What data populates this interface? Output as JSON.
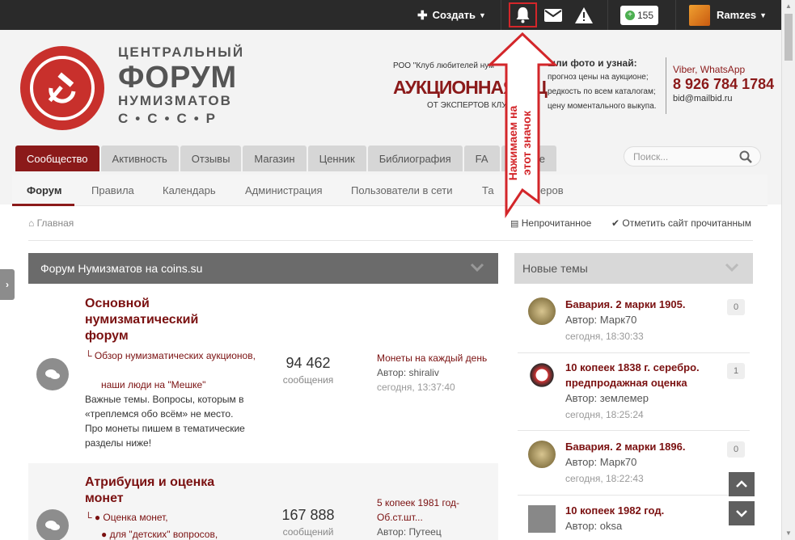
{
  "topbar": {
    "create_label": "Создать",
    "points": "155",
    "username": "Ramzes"
  },
  "header": {
    "logo": {
      "line1": "ЦЕНТРАЛЬНЫЙ",
      "line2": "ФОРУМ",
      "line3": "НУМИЗМАТОВ",
      "line4": "С•С•С•Р"
    },
    "ad": {
      "small": "РОО \"Клуб любителей нум",
      "big": "АУКЦИОННАЯ ОЦ",
      "sub": "ОТ ЭКСПЕРТОВ КЛУБА",
      "right_title": "шли фото и узнай:",
      "right_lines": [
        "прогноз цены на аукционе;",
        "редкость по всем каталогам;",
        "цену моментального выкупа."
      ],
      "viber": "Viber, WhatsApp",
      "phone_prefix": "8 926 ",
      "phone_main": "784 1784",
      "email": "bid@mailbid.ru"
    }
  },
  "nav": {
    "tabs": [
      "Сообщество",
      "Активность",
      "Отзывы",
      "Магазин",
      "Ценник",
      "Библиография",
      "FA",
      "ьше"
    ],
    "search_placeholder": "Поиск...",
    "subtabs": [
      "Форум",
      "Правила",
      "Календарь",
      "Администрация",
      "Пользователи в сети",
      "Та",
      "еров"
    ]
  },
  "breadcrumb": {
    "home": "Главная",
    "unread": "Непрочитанное",
    "mark_read": "Отметить сайт прочитанным"
  },
  "forum": {
    "category_title": "Форум Нумизматов на coins.su",
    "rows": [
      {
        "title": "Основной нумизматический форум",
        "sub1": "Обзор нумизматических аукционов,",
        "sub2": "наши люди на \"Мешке\"",
        "desc": "Важные темы. Вопросы, которым в «треплемся обо всём» не место. Про монеты пишем в тематические разделы ниже!",
        "count": "94 462",
        "count_label": "сообщения",
        "last_title": "Монеты на каждый день",
        "last_author": "Автор: shiraliv",
        "last_date": "сегодня, 13:37:40"
      },
      {
        "title": "Атрибуция и оценка монет",
        "sub1": "Оценка монет,",
        "sub2": "для \"детских\" вопросов,",
        "count": "167 888",
        "count_label": "сообщений",
        "last_title_1": "5 копеек 1981 год-",
        "last_title_2": "Об.ст.шт...",
        "last_author": "Автор: Путеец"
      }
    ]
  },
  "sidebar": {
    "title": "Новые темы",
    "topics": [
      {
        "title": "Бавария. 2 марки 1905.",
        "author": "Автор: Марк70",
        "date": "сегодня, 18:30:33",
        "count": "0"
      },
      {
        "title": "10 копеек 1838 г. серебро. предпродажная оценка",
        "author": "Автор: землемер",
        "date": "сегодня, 18:25:24",
        "count": "1"
      },
      {
        "title": "Бавария. 2 марки 1896.",
        "author": "Автор: Марк70",
        "date": "сегодня, 18:22:43",
        "count": "0"
      },
      {
        "title": "10 копеек 1982 год.",
        "author": "Автор: oksa",
        "date": "",
        "count": ""
      }
    ]
  },
  "annotation": {
    "line1": "Нажимаем на",
    "line2": "этот значок",
    "color": "#d3262a"
  }
}
